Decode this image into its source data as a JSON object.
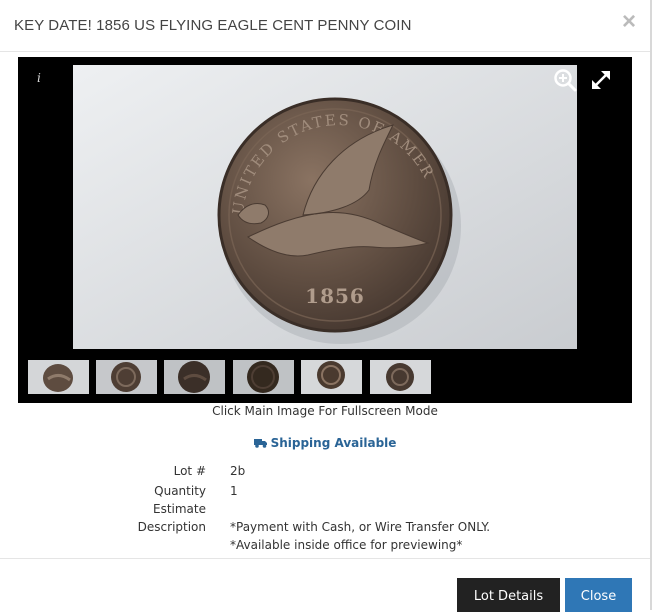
{
  "modal": {
    "title": "KEY DATE! 1856 US FLYING EAGLE CENT PENNY COIN",
    "close_symbol": "×"
  },
  "viewer": {
    "info_label": "i",
    "thumbnail_count": 6,
    "caption": "Click Main Image For Fullscreen Mode"
  },
  "shipping": {
    "icon": "truck-icon",
    "label": "Shipping Available",
    "color": "#2a6496"
  },
  "lot": {
    "lot_label": "Lot #",
    "lot_value": "2b",
    "quantity_label": "Quantity",
    "quantity_value": "1",
    "estimate_label": "Estimate",
    "estimate_value": "",
    "description_label": "Description",
    "description_lines": [
      "*Payment with Cash, or Wire Transfer ONLY.",
      "*Available inside office for previewing*"
    ]
  },
  "footer": {
    "lot_details_label": "Lot Details",
    "close_label": "Close",
    "close_color": "#2f77b6"
  },
  "coin": {
    "legend_text": "UNITED STATES OF AMERICA",
    "date_text": "1856"
  }
}
